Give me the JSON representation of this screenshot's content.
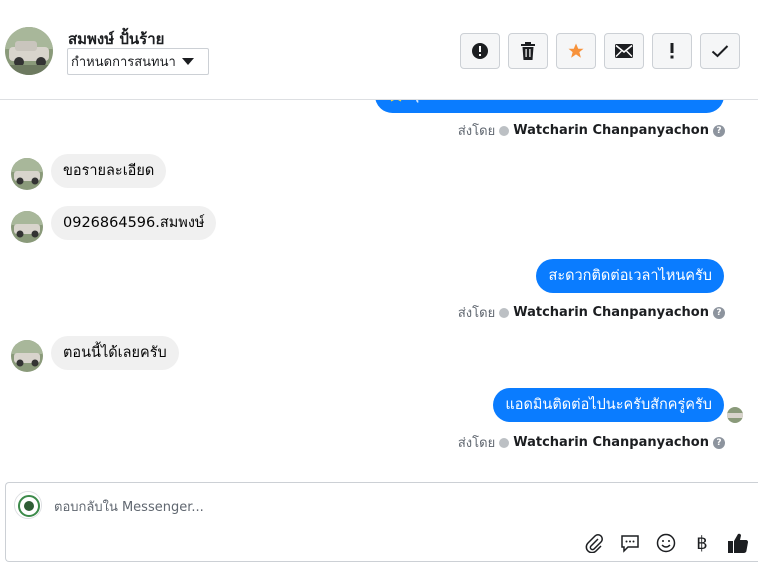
{
  "header": {
    "contact_name": "สมพงษ์ ปั้นร้าย",
    "assign_label": "กำหนดการสนทนา",
    "actions": [
      {
        "name": "report-button",
        "icon": "alert-circle-icon"
      },
      {
        "name": "delete-button",
        "icon": "trash-icon"
      },
      {
        "name": "star-button",
        "icon": "star-icon"
      },
      {
        "name": "mark-unread-button",
        "icon": "envelope-icon"
      },
      {
        "name": "follow-up-button",
        "icon": "exclamation-icon"
      },
      {
        "name": "mark-done-button",
        "icon": "check-icon"
      }
    ]
  },
  "messages": [
    {
      "id": "m0",
      "direction": "out",
      "text": "⭐ คุณต้องการสอบถามเกี่ยวกับรายละเอียดใช่ไหม",
      "sent_by_label": "ส่งโดย",
      "agent": "Watcharin Chanpanyachon"
    },
    {
      "id": "m1",
      "direction": "in",
      "text": "ขอรายละเอียด"
    },
    {
      "id": "m2",
      "direction": "in",
      "text": "0926864596.สมพงษ์"
    },
    {
      "id": "m3",
      "direction": "out",
      "text": "สะดวกติดต่อเวลาไหนครับ",
      "sent_by_label": "ส่งโดย",
      "agent": "Watcharin Chanpanyachon"
    },
    {
      "id": "m4",
      "direction": "in",
      "text": "ตอนนี้ได้เลยครับ"
    },
    {
      "id": "m5",
      "direction": "out",
      "text": "แอดมินติดต่อไปนะครับสักครู่ครับ",
      "sent_by_label": "ส่งโดย",
      "agent": "Watcharin Chanpanyachon"
    }
  ],
  "composer": {
    "placeholder": "ตอบกลับใน Messenger...",
    "tools": [
      "paperclip-icon",
      "chat-bubble-icon",
      "emoji-icon",
      "baht-icon",
      "thumbs-up-icon"
    ],
    "baht_glyph": "฿"
  },
  "colors": {
    "outgoing_bubble": "#0a7cff",
    "incoming_bubble": "#f0f0f0",
    "star": "#f7923b"
  }
}
